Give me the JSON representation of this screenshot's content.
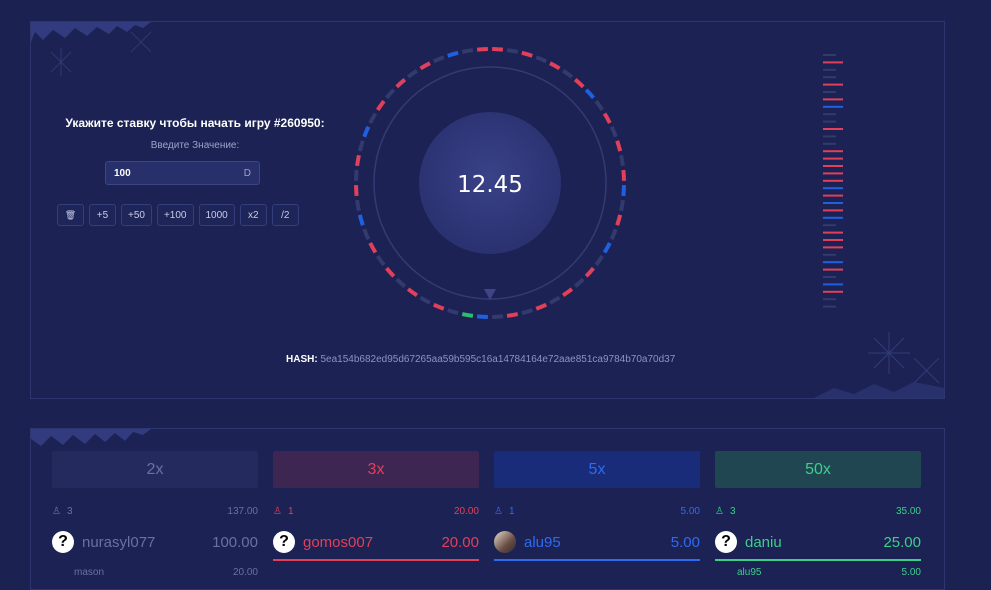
{
  "bet": {
    "title": "Укажите ставку чтобы начать игру #260950:",
    "subtitle": "Введите Значение:",
    "input_value": "100",
    "currency": "D",
    "quick": [
      "🗑",
      "+5",
      "+50",
      "+100",
      "1000",
      "x2",
      "/2"
    ]
  },
  "wheel": {
    "value": "12.45",
    "segments": [
      "red",
      "gray",
      "red",
      "gray",
      "red",
      "gray",
      "red",
      "blue",
      "gray",
      "red",
      "gray",
      "red",
      "gray",
      "red",
      "blue",
      "gray",
      "red",
      "gray",
      "blue",
      "gray",
      "red",
      "gray",
      "red",
      "gray",
      "red",
      "gray",
      "red",
      "gray",
      "blue",
      "green",
      "gray",
      "red",
      "gray",
      "red",
      "gray",
      "red",
      "gray",
      "red",
      "gray",
      "blue",
      "gray",
      "red",
      "gray",
      "red",
      "gray",
      "blue",
      "gray",
      "red",
      "gray",
      "red",
      "gray",
      "red",
      "gray",
      "blue",
      "gray",
      "red"
    ],
    "colors": {
      "red": "#e0405a",
      "blue": "#2060e0",
      "gray": "#323a6e",
      "green": "#2dbd6e"
    }
  },
  "hash": {
    "label": "HASH:",
    "value": "5ea154b682ed95d67265aa59b595c16a14784164e72aae851ca9784b70a70d37"
  },
  "history": [
    "gray",
    "red",
    "gray",
    "gray",
    "red",
    "gray",
    "red",
    "blue",
    "gray",
    "gray",
    "red",
    "gray",
    "gray",
    "red",
    "red",
    "red",
    "red",
    "red",
    "blue",
    "red",
    "blue",
    "red",
    "blue",
    "gray",
    "red",
    "red",
    "red",
    "gray",
    "blue",
    "red",
    "gray",
    "blue",
    "red",
    "gray",
    "gray"
  ],
  "columns": [
    {
      "mult": "2x",
      "head_bg": "#242a5e",
      "head_fg": "#6b70a0",
      "accent": "#6b70a0",
      "users": "3",
      "total": "137.00",
      "player": "nurasyl077",
      "amount": "100.00",
      "avatar": "?",
      "underline": "transparent",
      "next_name": "mason",
      "next_amount": "20.00"
    },
    {
      "mult": "3x",
      "head_bg": "#3e2653",
      "head_fg": "#e0405a",
      "accent": "#e0405a",
      "users": "1",
      "total": "20.00",
      "player": "gomos007",
      "amount": "20.00",
      "avatar": "?",
      "underline": "#e0405a",
      "next_name": "",
      "next_amount": ""
    },
    {
      "mult": "5x",
      "head_bg": "#182c7a",
      "head_fg": "#2f6bf0",
      "accent": "#2f6bf0",
      "users": "1",
      "total": "5.00",
      "player": "alu95",
      "amount": "5.00",
      "avatar": "img",
      "underline": "#2f6bf0",
      "next_name": "",
      "next_amount": ""
    },
    {
      "mult": "50x",
      "head_bg": "#1f4651",
      "head_fg": "#3ccf8a",
      "accent": "#3ccf8a",
      "users": "3",
      "total": "35.00",
      "player": "daniu",
      "amount": "25.00",
      "avatar": "?",
      "underline": "#3ccf8a",
      "next_name": "alu95",
      "next_amount": "5.00"
    }
  ]
}
